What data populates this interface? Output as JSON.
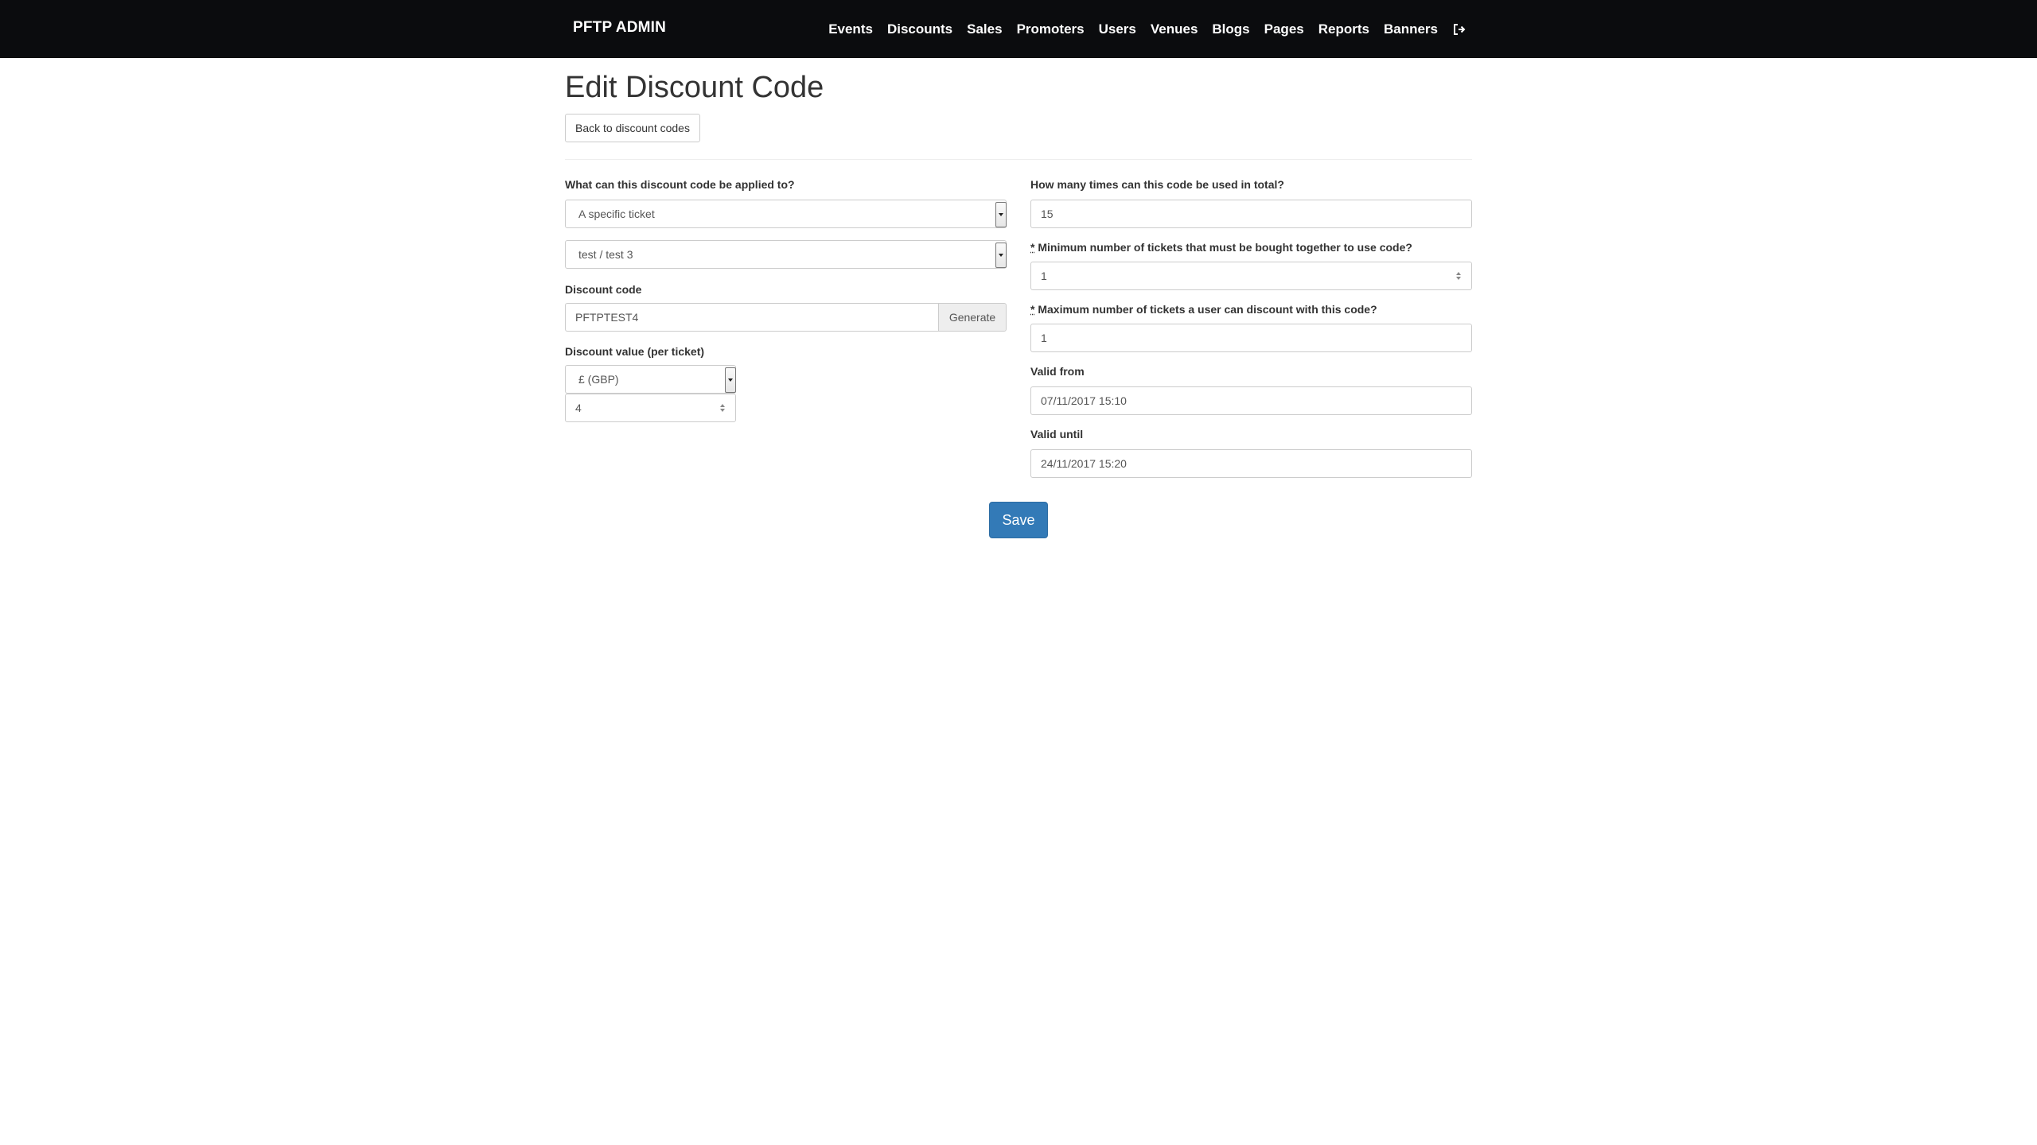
{
  "navbar": {
    "brand": "PFTP ADMIN",
    "links": [
      "Events",
      "Discounts",
      "Sales",
      "Promoters",
      "Users",
      "Venues",
      "Blogs",
      "Pages",
      "Reports",
      "Banners"
    ]
  },
  "page": {
    "title": "Edit Discount Code",
    "back_button": "Back to discount codes"
  },
  "form": {
    "applies_to": {
      "label": "What can this discount code be applied to?",
      "value": "A specific ticket"
    },
    "ticket": {
      "value": "test / test 3"
    },
    "discount_code": {
      "label": "Discount code",
      "value": "PFTPTEST4",
      "generate_label": "Generate"
    },
    "discount_value": {
      "label": "Discount value (per ticket)",
      "currency": "£ (GBP)",
      "amount": "4"
    },
    "total_uses": {
      "label": "How many times can this code be used in total?",
      "value": "15"
    },
    "min_tickets": {
      "required_mark": "*",
      "label": "Minimum number of tickets that must be bought together to use code?",
      "value": "1"
    },
    "max_tickets": {
      "required_mark": "*",
      "label": "Maximum number of tickets a user can discount with this code?",
      "value": "1"
    },
    "valid_from": {
      "label": "Valid from",
      "value": "07/11/2017 15:10"
    },
    "valid_until": {
      "label": "Valid until",
      "value": "24/11/2017 15:20"
    },
    "save_label": "Save"
  },
  "icons": {
    "logout": "logout-icon"
  }
}
